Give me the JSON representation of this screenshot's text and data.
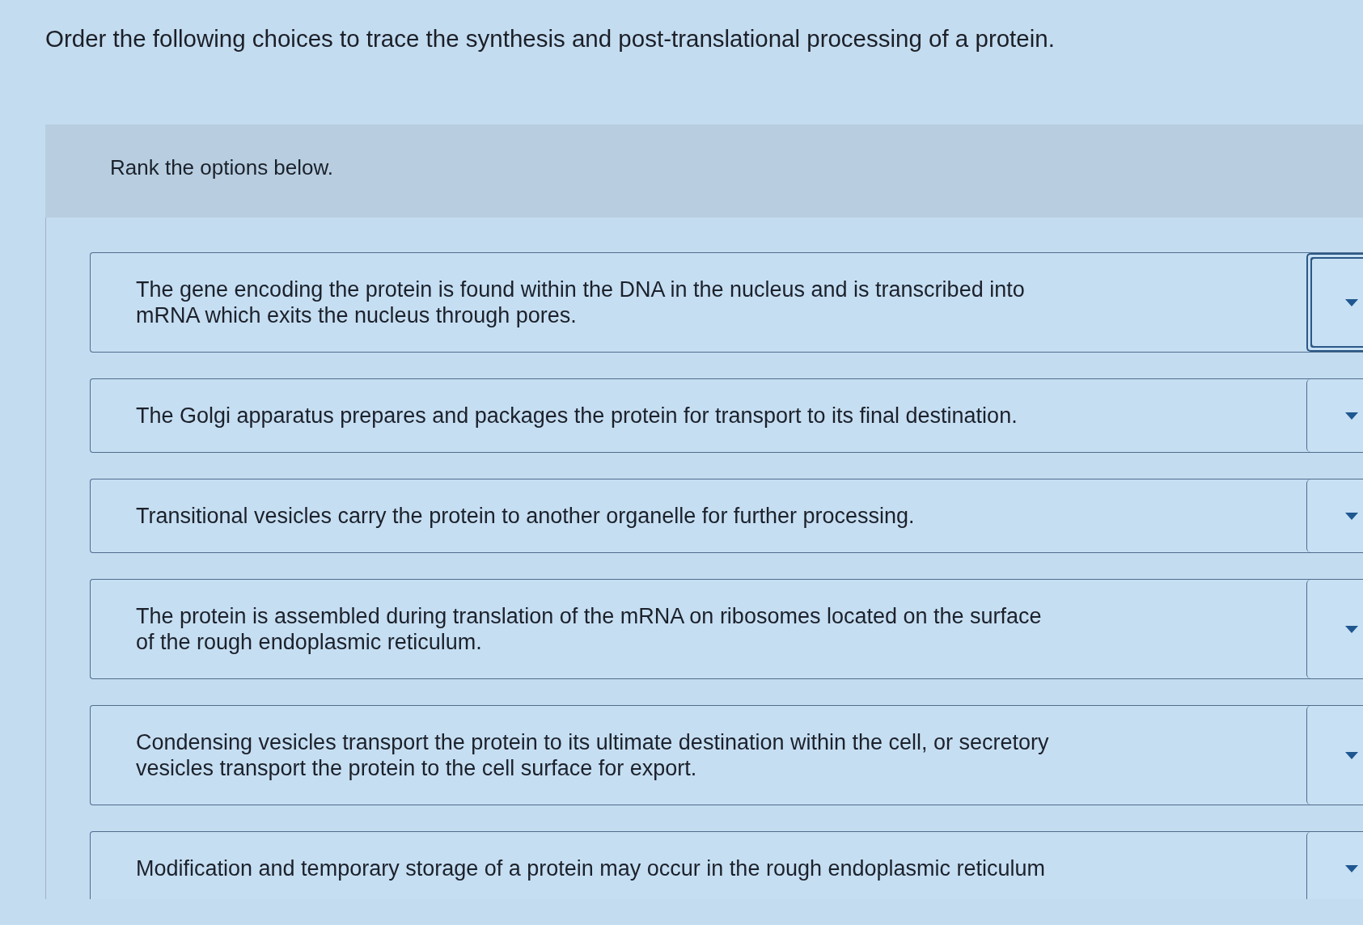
{
  "prompt": "Order the following choices to trace the synthesis and post-translational processing of a protein.",
  "ranking": {
    "instruction": "Rank the options below.",
    "options": [
      {
        "text": "The gene encoding the protein is found within the DNA in the nucleus and is transcribed into mRNA which exits the nucleus through pores.",
        "focused": true
      },
      {
        "text": "The Golgi apparatus prepares and packages the protein for transport to its final destination.",
        "focused": false
      },
      {
        "text": "Transitional vesicles carry the protein to another organelle for further processing.",
        "focused": false
      },
      {
        "text": "The protein is assembled during translation of the mRNA on ribosomes located on the surface of the rough endoplasmic reticulum.",
        "focused": false
      },
      {
        "text": "Condensing vesicles transport the protein to its ultimate destination within the cell, or secretory vesicles transport the protein to the cell surface for export.",
        "focused": false
      },
      {
        "text": "Modification and temporary storage of a protein may occur in the rough endoplasmic reticulum",
        "focused": false
      }
    ]
  }
}
